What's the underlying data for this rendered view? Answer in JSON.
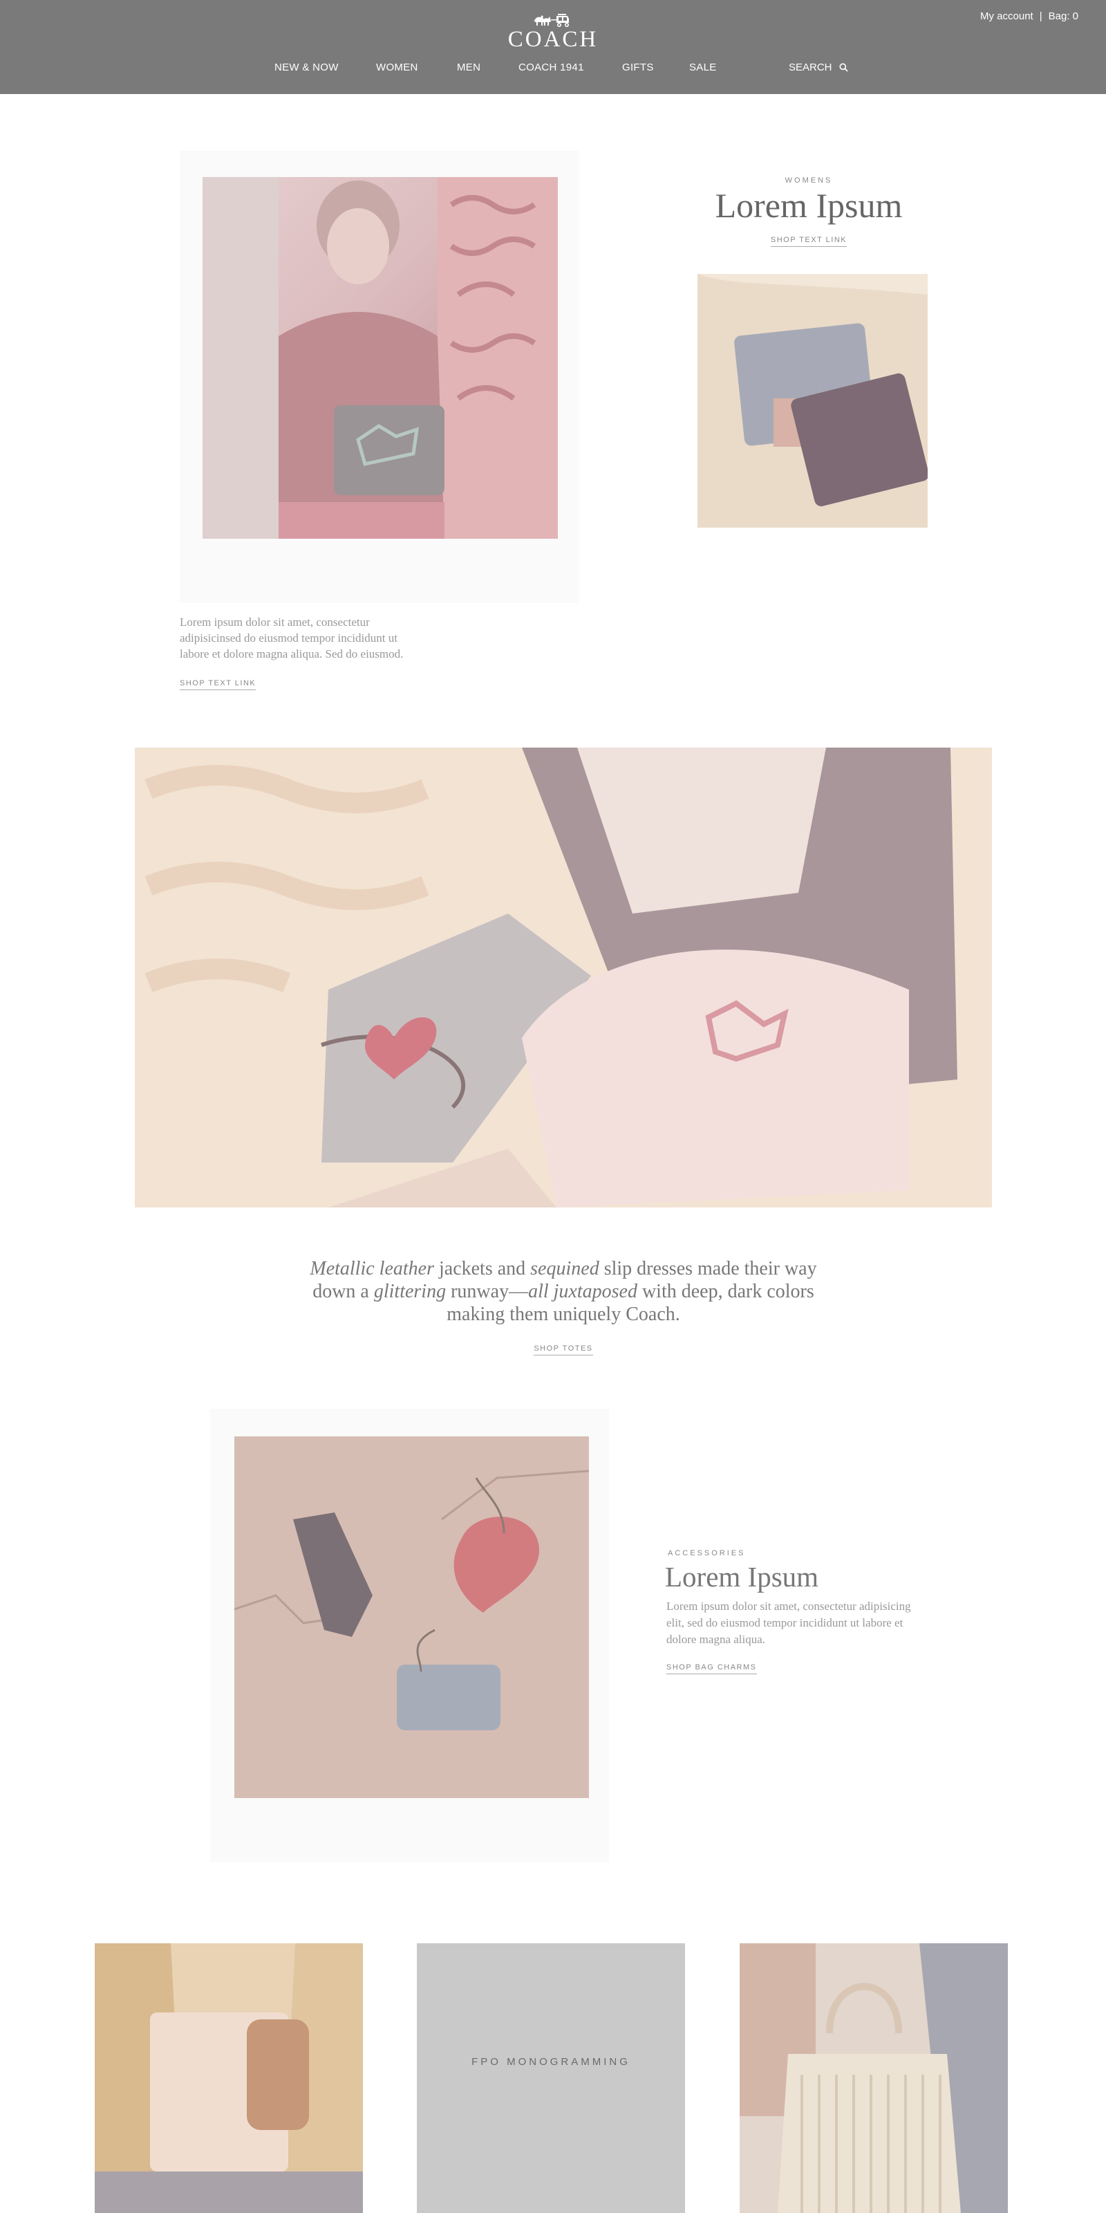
{
  "header": {
    "logo_text": "COACH",
    "account_label": "My account",
    "separator": "|",
    "bag_label": "Bag: 0",
    "nav": [
      "NEW & NOW",
      "WOMEN",
      "MEN",
      "COACH 1941",
      "GIFTS",
      "SALE"
    ],
    "search_label": "SEARCH"
  },
  "section1": {
    "copy": "Lorem ipsum dolor sit amet, consectetur adipisicinsed do eiusmod tempor incididunt ut labore et dolore magna aliqua. Sed do eiusmod.",
    "link": "SHOP TEXT LINK"
  },
  "section2": {
    "kicker": "WOMENS",
    "title": "Lorem Ipsum",
    "link": "SHOP TEXT LINK"
  },
  "quote": {
    "part1": "Metallic leather",
    "part2": " jackets and ",
    "part3": "sequined",
    "part4": " slip dresses made their way down a ",
    "part5": "glittering",
    "part6": " runway—",
    "part7": "all juxtaposed",
    "part8": " with deep, dark colors making them uniquely Coach.",
    "link": "SHOP TOTES"
  },
  "section3": {
    "kicker": "ACCESSORIES",
    "title": "Lorem Ipsum",
    "copy": "Lorem ipsum dolor sit amet, consectetur adipisicing elit, sed do eiusmod tempor incididunt ut labore et dolore magna aliqua.",
    "link": "SHOP BAG CHARMS"
  },
  "bottom": {
    "placeholder_label": "FPO MONOGRAMMING"
  },
  "colors": {
    "header_bg": "#7a7a7a",
    "placeholder_bg": "#c9c9c9"
  },
  "icons": {
    "logo": "horse-and-carriage-icon",
    "search": "magnifier-icon"
  }
}
